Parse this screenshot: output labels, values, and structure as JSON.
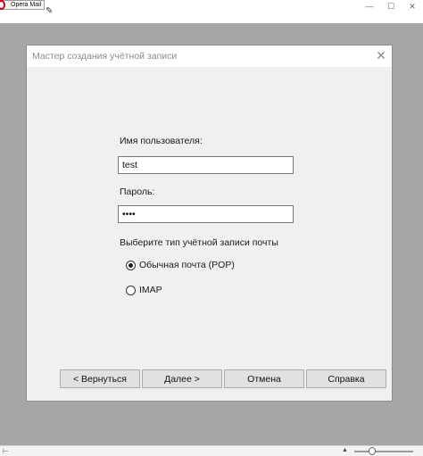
{
  "app": {
    "badge_label": "Opera Mail",
    "window_controls": {
      "minimize": "—",
      "maximize": "☐",
      "close": "✕"
    }
  },
  "dialog": {
    "title": "Мастер создания учётной записи",
    "close_glyph": "✕",
    "username_label": "Имя пользователя:",
    "username_value": "test",
    "password_label": "Пароль:",
    "password_value": "test",
    "account_type_label": "Выберите тип учётной записи почты",
    "account_types": [
      {
        "label": "Обычная почта (POP)",
        "selected": true
      },
      {
        "label": "IMAP",
        "selected": false
      }
    ],
    "buttons": {
      "back": "< Вернуться",
      "next": "Далее >",
      "cancel": "Отмена",
      "help": "Справка"
    }
  },
  "statusbar": {
    "left_glyph": "⊢",
    "zoom_up": "▲"
  },
  "colors": {
    "backdrop": "#a6a6a6",
    "dialog_bg": "#f0f0f0",
    "opera_red": "#d0021b"
  },
  "icons": [
    "opera-logo-icon",
    "compose-icon",
    "close-icon",
    "minimize-icon",
    "maximize-icon"
  ]
}
